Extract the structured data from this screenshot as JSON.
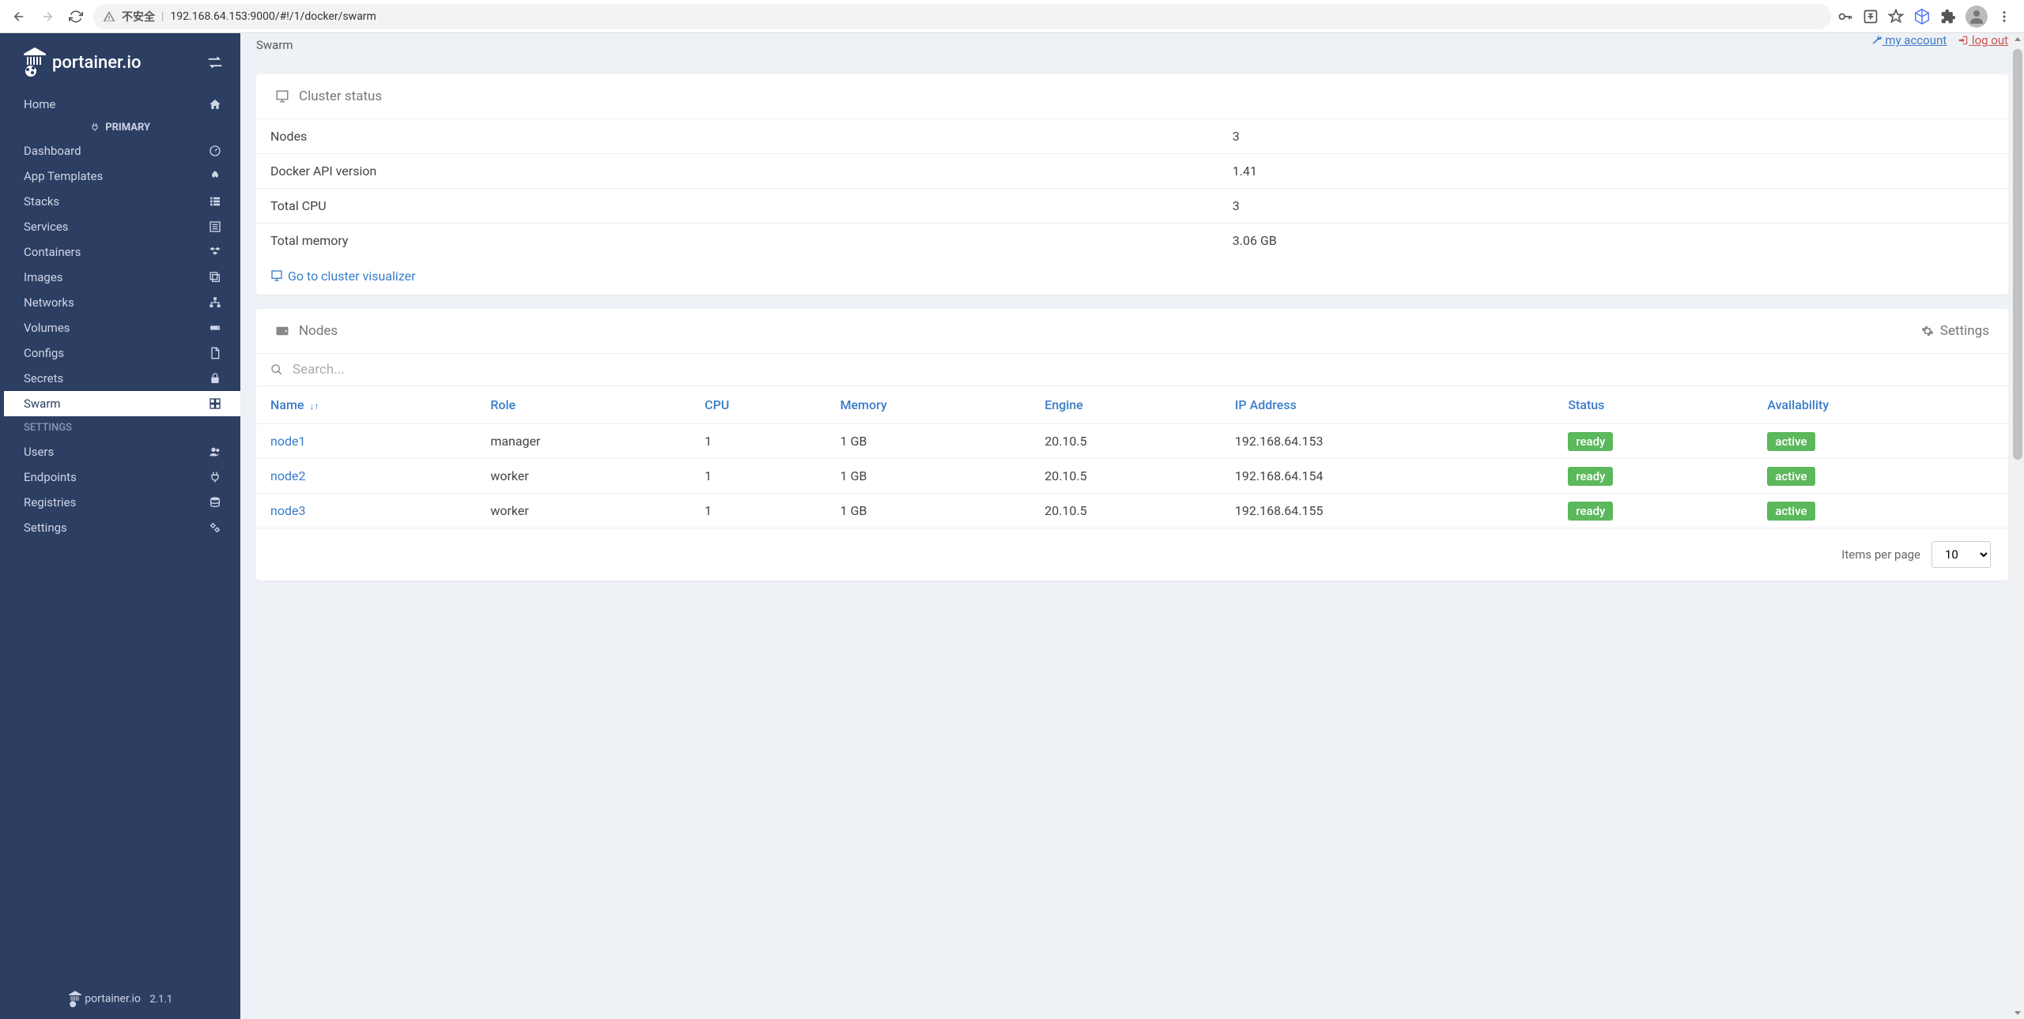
{
  "browser": {
    "not_secure": "不安全",
    "url": "192.168.64.153:9000/#!/1/docker/swarm"
  },
  "sidebar": {
    "logo_text": "portainer.io",
    "primary_label": "PRIMARY",
    "settings_label": "SETTINGS",
    "version": "2.1.1",
    "items_top": [
      {
        "label": "Home",
        "icon": "home"
      }
    ],
    "items_env": [
      {
        "label": "Dashboard",
        "icon": "dashboard"
      },
      {
        "label": "App Templates",
        "icon": "rocket"
      },
      {
        "label": "Stacks",
        "icon": "list"
      },
      {
        "label": "Services",
        "icon": "listalt"
      },
      {
        "label": "Containers",
        "icon": "cubes"
      },
      {
        "label": "Images",
        "icon": "clone"
      },
      {
        "label": "Networks",
        "icon": "sitemap"
      },
      {
        "label": "Volumes",
        "icon": "hdd"
      },
      {
        "label": "Configs",
        "icon": "file"
      },
      {
        "label": "Secrets",
        "icon": "lock"
      },
      {
        "label": "Swarm",
        "icon": "object",
        "active": true
      }
    ],
    "items_settings": [
      {
        "label": "Users",
        "icon": "users"
      },
      {
        "label": "Endpoints",
        "icon": "plug"
      },
      {
        "label": "Registries",
        "icon": "database"
      },
      {
        "label": "Settings",
        "icon": "cogs"
      }
    ]
  },
  "header": {
    "breadcrumb": "Swarm",
    "my_account": "my account",
    "log_out": "log out"
  },
  "cluster_status": {
    "title": "Cluster status",
    "rows": [
      {
        "label": "Nodes",
        "value": "3"
      },
      {
        "label": "Docker API version",
        "value": "1.41"
      },
      {
        "label": "Total CPU",
        "value": "3"
      },
      {
        "label": "Total memory",
        "value": "3.06 GB"
      }
    ],
    "visualizer_link": "Go to cluster visualizer"
  },
  "nodes_panel": {
    "title": "Nodes",
    "settings": "Settings",
    "search_placeholder": "Search...",
    "columns": [
      "Name",
      "Role",
      "CPU",
      "Memory",
      "Engine",
      "IP Address",
      "Status",
      "Availability"
    ],
    "rows": [
      {
        "name": "node1",
        "role": "manager",
        "cpu": "1",
        "memory": "1 GB",
        "engine": "20.10.5",
        "ip": "192.168.64.153",
        "status": "ready",
        "availability": "active"
      },
      {
        "name": "node2",
        "role": "worker",
        "cpu": "1",
        "memory": "1 GB",
        "engine": "20.10.5",
        "ip": "192.168.64.154",
        "status": "ready",
        "availability": "active"
      },
      {
        "name": "node3",
        "role": "worker",
        "cpu": "1",
        "memory": "1 GB",
        "engine": "20.10.5",
        "ip": "192.168.64.155",
        "status": "ready",
        "availability": "active"
      }
    ],
    "items_per_page_label": "Items per page",
    "items_per_page_value": "10"
  }
}
